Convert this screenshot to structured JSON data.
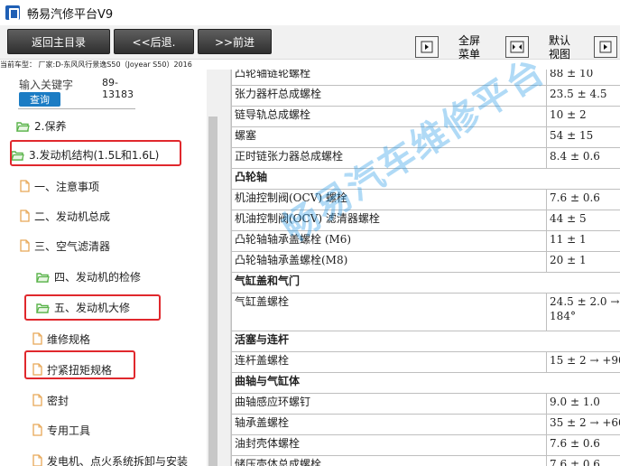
{
  "window": {
    "title": "畅易汽修平台V9"
  },
  "toolbar": {
    "back_main": "返回主目录",
    "back": "<<后退.",
    "forward": ">>前进",
    "fullscreen_label_1": "全屏",
    "fullscreen_label_2": "菜单",
    "default_label_1": "默认",
    "default_label_2": "视图"
  },
  "car_info": "当前车型：  厂家:D-东风风行景逸S50（Joyear S50）2016",
  "search": {
    "label": "输入关键字",
    "value_line1": "89-",
    "value_line2": "13183",
    "button": "查询"
  },
  "tree": [
    {
      "label": "2.保养",
      "icon": "folder-open-icon"
    },
    {
      "label": "3.发动机结构(1.5L和1.6L)",
      "icon": "folder-open-icon"
    },
    {
      "label": "一、注意事项",
      "icon": "document-icon"
    },
    {
      "label": "二、发动机总成",
      "icon": "document-icon"
    },
    {
      "label": "三、空气滤清器",
      "icon": "document-icon"
    },
    {
      "label": "四、发动机的检修",
      "icon": "folder-open-icon"
    },
    {
      "label": "五、发动机大修",
      "icon": "folder-open-icon"
    },
    {
      "label": "维修规格",
      "icon": "document-icon"
    },
    {
      "label": "拧紧扭矩规格",
      "icon": "document-icon"
    },
    {
      "label": "密封",
      "icon": "document-icon"
    },
    {
      "label": "专用工具",
      "icon": "document-icon"
    },
    {
      "label": "发电机、点火系统拆卸与安装",
      "icon": "document-icon"
    }
  ],
  "table": [
    {
      "name": "凸轮轴链轮螺栓",
      "value": "88 ± 10"
    },
    {
      "name": "张力器杆总成螺栓",
      "value": "23.5 ± 4.5"
    },
    {
      "name": "链导轨总成螺栓",
      "value": "10 ± 2"
    },
    {
      "name": "螺塞",
      "value": "54 ± 15"
    },
    {
      "name": "正时链张力器总成螺栓",
      "value": "8.4 ± 0.6"
    },
    {
      "section": "凸轮轴"
    },
    {
      "name": "机油控制阀(OCV)  螺栓",
      "value": "7.6 ± 0.6"
    },
    {
      "name": "机油控制阀(OCV)  滤清器螺栓",
      "value": "44 ± 5"
    },
    {
      "name": "凸轮轴轴承盖螺栓 (M6)",
      "value": "11 ± 1"
    },
    {
      "name": "凸轮轴轴承盖螺栓(M8)",
      "value": "20 ± 1"
    },
    {
      "section": "气缸盖和气门"
    },
    {
      "name": "气缸盖螺栓",
      "value": "24.5 ± 2.0 →",
      "value2": "184°"
    },
    {
      "section": "活塞与连杆"
    },
    {
      "name": "连杆盖螺栓",
      "value": "15 ± 2 → +90"
    },
    {
      "section": "曲轴与气缸体"
    },
    {
      "name": "曲轴感应环螺钉",
      "value": "9.0 ± 1.0"
    },
    {
      "name": "轴承盖螺栓",
      "value": "35 ± 2 → +60"
    },
    {
      "name": "油封壳体螺栓",
      "value": "7.6 ± 0.6"
    },
    {
      "name": "储压壳体总成螺栓",
      "value": "7.6 ± 0.6"
    }
  ],
  "watermark": "畅易汽车维修平台",
  "colors": {
    "highlight_box": "#e0282d",
    "query_button": "#1b7cc4",
    "folder": "#5ab34a",
    "doc": "#e8a857",
    "watermark": "#1e96e6"
  }
}
